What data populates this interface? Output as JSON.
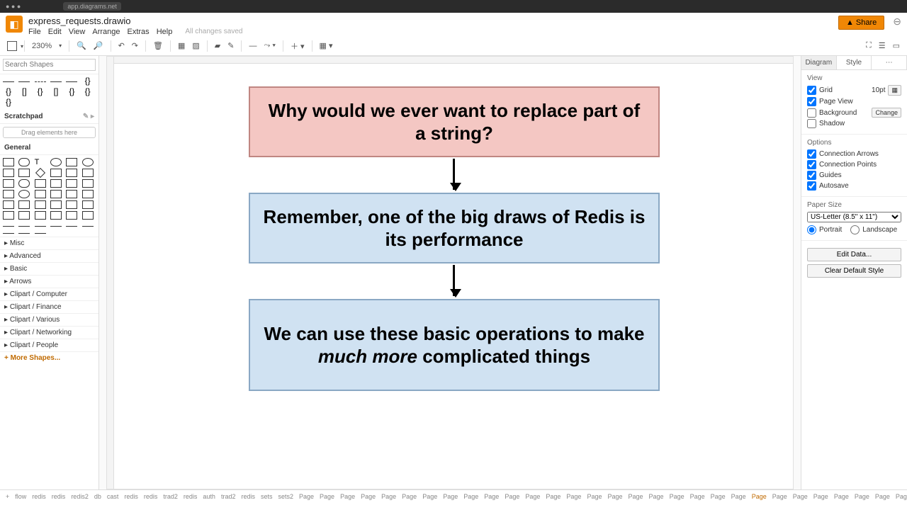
{
  "browser": {
    "url": "app.diagrams.net"
  },
  "doc": {
    "title": "express_requests.drawio",
    "save_status": "All changes saved"
  },
  "menu": [
    "File",
    "Edit",
    "View",
    "Arrange",
    "Extras",
    "Help"
  ],
  "share_label": "▲ Share",
  "toolbar": {
    "zoom": "230%"
  },
  "left": {
    "search_placeholder": "Search Shapes",
    "scratchpad": "Scratchpad",
    "drop_hint": "Drag elements here",
    "general": "General",
    "categories": [
      "Misc",
      "Advanced",
      "Basic",
      "Arrows",
      "Clipart / Computer",
      "Clipart / Finance",
      "Clipart / Various",
      "Clipart / Networking",
      "Clipart / People"
    ],
    "more": "+ More Shapes..."
  },
  "flow": {
    "box1": "Why would we ever want to replace part of a string?",
    "box2": "Remember, one of the big draws of Redis is its performance",
    "box3_a": "We can use these basic operations to make ",
    "box3_b": "much more",
    "box3_c": " complicated things"
  },
  "right": {
    "tab_diagram": "Diagram",
    "tab_style": "Style",
    "view": "View",
    "grid": "Grid",
    "grid_val": "10pt",
    "page_view": "Page View",
    "background": "Background",
    "change": "Change",
    "shadow": "Shadow",
    "options": "Options",
    "conn_arrows": "Connection Arrows",
    "conn_points": "Connection Points",
    "guides": "Guides",
    "autosave": "Autosave",
    "paper_size": "Paper Size",
    "paper_value": "US-Letter (8.5\" x 11\")",
    "portrait": "Portrait",
    "landscape": "Landscape",
    "edit_data": "Edit Data...",
    "clear_style": "Clear Default Style"
  },
  "bottom": {
    "plus": "+",
    "prefix_tabs": [
      "flow",
      "redis",
      "redis",
      "redis2",
      "db",
      "cast",
      "redis",
      "redis",
      "trad2",
      "redis",
      "auth",
      "trad2",
      "redis",
      "sets",
      "sets2"
    ],
    "page_word": "Page",
    "active_page": "Page"
  }
}
